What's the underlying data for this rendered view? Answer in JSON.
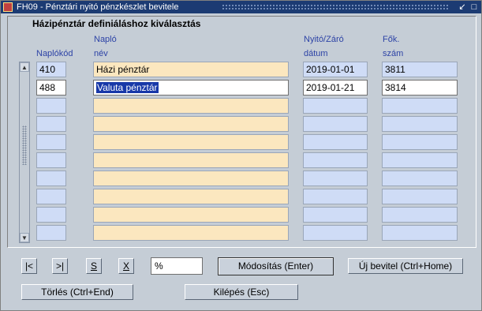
{
  "window": {
    "title": "FH09 - Pénztári nyitó pénzkészlet bevitele"
  },
  "heading": "Házipénztár definiáláshoz kiválasztás",
  "columns": {
    "code": {
      "line1": "",
      "line2": "Naplókód"
    },
    "name": {
      "line1": "Napló",
      "line2": "név"
    },
    "date": {
      "line1": "Nyitó/Záró",
      "line2": "dátum"
    },
    "account": {
      "line1": "Fők.",
      "line2": "szám"
    }
  },
  "rows": [
    {
      "code": "410",
      "name": "Házi pénztár",
      "date": "2019-01-01",
      "account": "3811"
    },
    {
      "code": "488",
      "name": "Valuta pénztár",
      "date": "2019-01-21",
      "account": "3814"
    },
    {
      "code": "",
      "name": "",
      "date": "",
      "account": ""
    },
    {
      "code": "",
      "name": "",
      "date": "",
      "account": ""
    },
    {
      "code": "",
      "name": "",
      "date": "",
      "account": ""
    },
    {
      "code": "",
      "name": "",
      "date": "",
      "account": ""
    },
    {
      "code": "",
      "name": "",
      "date": "",
      "account": ""
    },
    {
      "code": "",
      "name": "",
      "date": "",
      "account": ""
    },
    {
      "code": "",
      "name": "",
      "date": "",
      "account": ""
    },
    {
      "code": "",
      "name": "",
      "date": "",
      "account": ""
    }
  ],
  "nav": {
    "first": "|<",
    "last": ">|",
    "search": "S",
    "clear": "X"
  },
  "filter_value": "%",
  "buttons": {
    "modify": "Módosítás (Enter)",
    "new": "Új bevitel (Ctrl+Home)",
    "delete": "Törlés (Ctrl+End)",
    "exit": "Kilépés (Esc)"
  },
  "colors": {
    "titlebar": "#1c3b73",
    "selection": "#1838a8",
    "name_field": "#fbe7bf",
    "field": "#cfdcf6"
  }
}
